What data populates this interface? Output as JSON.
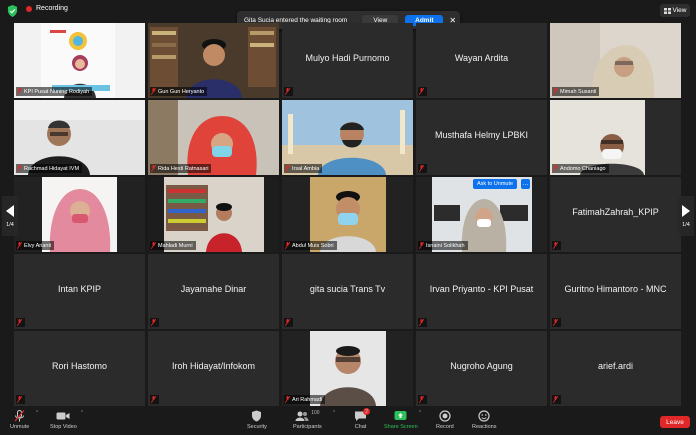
{
  "topbar": {
    "recording_label": "Recording",
    "notification_text": "Gita Sucia entered the waiting room",
    "view_button": "View",
    "admit_button": "Admit",
    "view_menu_label": "View"
  },
  "tiles": [
    {
      "name": "KPI Pusat Nuning Rodiyah",
      "video": true
    },
    {
      "name": "Gun Gun Heryanto",
      "video": true
    },
    {
      "name": "Mulyo Hadi Purnomo",
      "video": false
    },
    {
      "name": "Wayan Ardita",
      "video": false
    },
    {
      "name": "Mimah Susanti",
      "video": true
    },
    {
      "name": "Rachmad Hidayat IVM",
      "video": true
    },
    {
      "name": "Rida Hesti Ratnasari",
      "video": true
    },
    {
      "name": "Irsal Ambia",
      "video": true
    },
    {
      "name": "Musthafa Helmy LPBKI",
      "video": false
    },
    {
      "name": "Andomo Chaniago",
      "video": true
    },
    {
      "name": "Elvy Arianti",
      "video": true
    },
    {
      "name": "Mahladi Murni",
      "video": true
    },
    {
      "name": "Abdul Muis Sobri",
      "video": true
    },
    {
      "name": "Isnaini Solikhah",
      "video": true
    },
    {
      "name": "FatimahZahrah_KPIP",
      "video": false
    },
    {
      "name": "Intan KPIP",
      "video": false
    },
    {
      "name": "Jayamahe Dinar",
      "video": false
    },
    {
      "name": "gita sucia Trans Tv",
      "video": false
    },
    {
      "name": "Irvan Priyanto - KPI Pusat",
      "video": false
    },
    {
      "name": "Guritno Himantoro - MNC",
      "video": false
    },
    {
      "name": "Rori Hastomo",
      "video": false
    },
    {
      "name": "Iroh Hidayat/Infokom",
      "video": false
    },
    {
      "name": "Ari Rahmadi",
      "video": true
    },
    {
      "name": "Nugroho Agung",
      "video": false
    },
    {
      "name": "arief.ardi",
      "video": false
    }
  ],
  "tile_overlay": {
    "ask_to_unmute": "Ask to Unmute",
    "more": "…"
  },
  "pagination": {
    "left": "1/4",
    "right": "1/4"
  },
  "toolbar": {
    "unmute": "Unmute",
    "stop_video": "Stop Video",
    "security": "Security",
    "participants": "Participants",
    "participants_count": "100",
    "chat": "Chat",
    "chat_badge": "2",
    "share_screen": "Share Screen",
    "record": "Record",
    "reactions": "Reactions",
    "leave": "Leave"
  },
  "colors": {
    "accent_blue": "#0e72ed",
    "share_green": "#2dc15b",
    "recording_red": "#e02828",
    "active_speaker": "#c7e46a",
    "tile_bg": "#2b2b2b"
  }
}
